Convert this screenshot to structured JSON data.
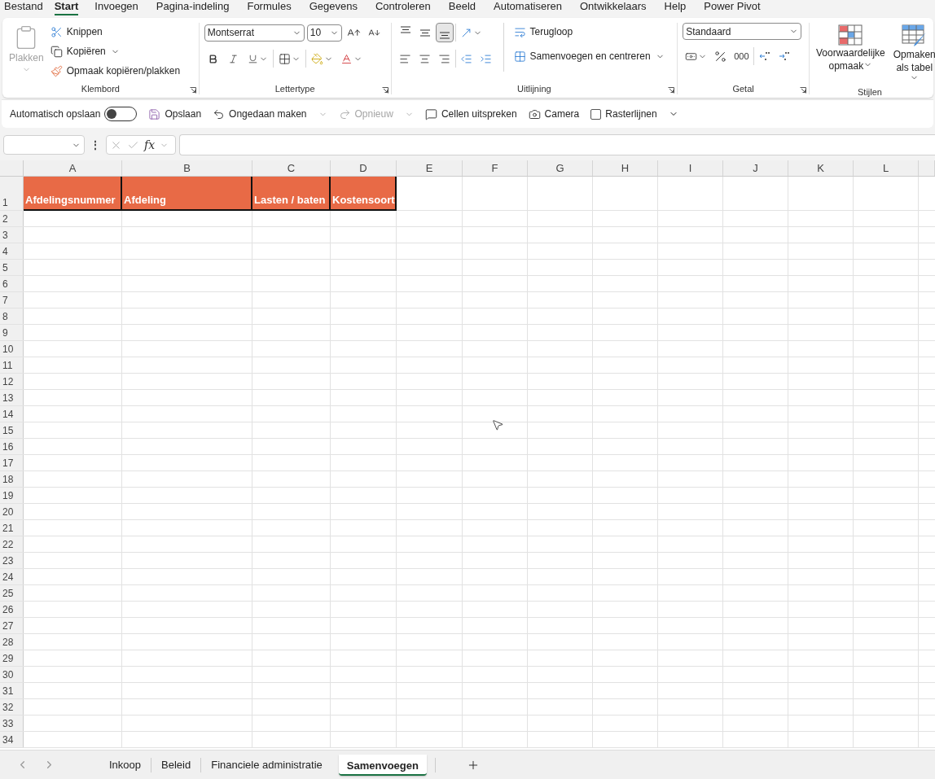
{
  "menu_tabs": [
    {
      "label": "Bestand",
      "selected": false
    },
    {
      "label": "Start",
      "selected": true
    },
    {
      "label": "Invoegen",
      "selected": false
    },
    {
      "label": "Pagina-indeling",
      "selected": false
    },
    {
      "label": "Formules",
      "selected": false
    },
    {
      "label": "Gegevens",
      "selected": false
    },
    {
      "label": "Controleren",
      "selected": false
    },
    {
      "label": "Beeld",
      "selected": false
    },
    {
      "label": "Automatiseren",
      "selected": false
    },
    {
      "label": "Ontwikkelaars",
      "selected": false
    },
    {
      "label": "Help",
      "selected": false
    },
    {
      "label": "Power Pivot",
      "selected": false
    }
  ],
  "ribbon": {
    "clipboard": {
      "label": "Klembord",
      "paste": {
        "label": "Plakken",
        "disabled": true
      },
      "cut": "Knippen",
      "copy": "Kopiëren",
      "format_painter": "Opmaak kopiëren/plakken"
    },
    "font": {
      "label": "Lettertype",
      "font_name": "Montserrat",
      "font_size": "10"
    },
    "alignment": {
      "label": "Uitlijning",
      "vertical": [
        {
          "kind": "top",
          "selected": false
        },
        {
          "kind": "middle",
          "selected": false
        },
        {
          "kind": "bottom",
          "selected": true
        }
      ],
      "wrap": "Terugloop",
      "merge": "Samenvoegen en centreren"
    },
    "number": {
      "label": "Getal",
      "format": "Standaard",
      "thousands": "000"
    },
    "styles": {
      "label": "Stijlen",
      "conditional": [
        "Voorwaardelijke",
        "opmaak"
      ],
      "table": [
        "Opmaken",
        "als tabel"
      ]
    }
  },
  "quick_access": [
    {
      "kind": "toggle",
      "label": "Automatisch opslaan",
      "on": false
    },
    {
      "kind": "save",
      "label": "Opslaan",
      "disabled": false
    },
    {
      "kind": "undo",
      "label": "Ongedaan maken",
      "disabled": false
    },
    {
      "kind": "redo",
      "label": "Opnieuw",
      "disabled": true
    },
    {
      "kind": "speak",
      "label": "Cellen uitspreken",
      "disabled": false
    },
    {
      "kind": "camera",
      "label": "Camera",
      "disabled": false
    },
    {
      "kind": "checkbox",
      "label": "Rasterlijnen",
      "checked": false
    }
  ],
  "formula_bar": {
    "more": "⋮",
    "fx": "fx"
  },
  "sheet": {
    "columns": [
      "A",
      "B",
      "C",
      "D",
      "E",
      "F",
      "G",
      "H",
      "I",
      "J",
      "K",
      "L"
    ],
    "rows": [
      "1",
      "2",
      "3",
      "4",
      "5",
      "6",
      "7",
      "8",
      "9",
      "10",
      "11",
      "12",
      "13",
      "14",
      "15",
      "16",
      "17",
      "18",
      "19",
      "20",
      "21",
      "22",
      "23",
      "24",
      "25",
      "26",
      "27",
      "28",
      "29",
      "30",
      "31",
      "32",
      "33",
      "34"
    ],
    "header_cells": [
      "Afdelingsnummer",
      "Afdeling",
      "Lasten / baten",
      "Kostensoort"
    ]
  },
  "sheet_tabs": [
    {
      "label": "Inkoop",
      "selected": false
    },
    {
      "label": "Beleid",
      "selected": false
    },
    {
      "label": "Financiele administratie",
      "selected": false
    },
    {
      "label": "Samenvoegen",
      "selected": true
    }
  ]
}
